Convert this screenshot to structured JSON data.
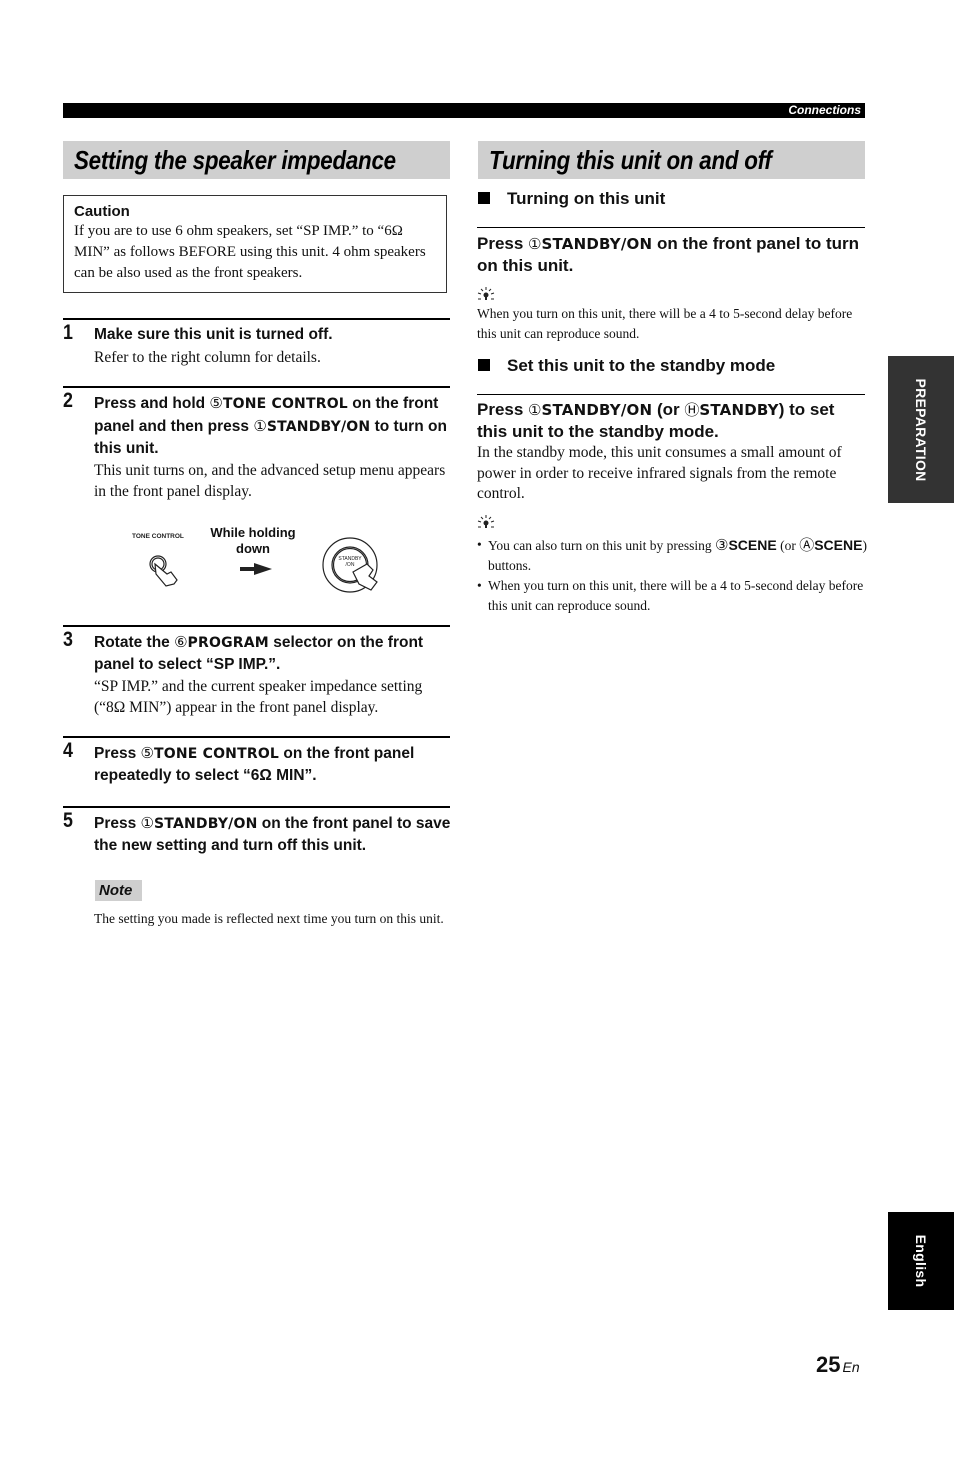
{
  "header": {
    "section": "Connections"
  },
  "left": {
    "title": "Setting the speaker impedance",
    "caution": {
      "heading": "Caution",
      "text": "If you are to use 6 ohm speakers, set “SP IMP.” to “6Ω MIN” as follows BEFORE using this unit. 4 ohm speakers can be also used as the front speakers."
    },
    "steps": [
      {
        "number": "1",
        "instruction": "Make sure this unit is turned off.",
        "description": "Refer to the right column for details."
      },
      {
        "number": "2",
        "instruction_parts": [
          "Press and hold ",
          "⑤",
          "TONE CONTROL",
          " on the front panel and then press ",
          "①",
          "STANDBY/ON",
          " to turn on this unit."
        ],
        "description": "This unit turns on, and the advanced setup menu appears in the front panel display."
      },
      {
        "number": "3",
        "instruction_parts": [
          "Rotate the ",
          "⑥",
          "PROGRAM",
          " selector on the front panel to select “SP IMP.”."
        ],
        "description": "“SP IMP.” and the current speaker impedance setting (“8Ω MIN”) appear in the front panel display."
      },
      {
        "number": "4",
        "instruction_parts": [
          "Press ",
          "⑤",
          "TONE CONTROL",
          " on the front panel repeatedly to select “6Ω MIN”."
        ]
      },
      {
        "number": "5",
        "instruction_parts": [
          "Press ",
          "①",
          "STANDBY/ON",
          " on the front panel to save the new setting and turn off this unit."
        ]
      }
    ],
    "illustration": {
      "tone_control_label": "TONE CONTROL",
      "while_holding": "While holding down",
      "standby_label": "STANDBY /ON"
    },
    "note": {
      "label": "Note",
      "text": "The setting you made is reflected next time you turn on this unit."
    }
  },
  "right": {
    "title": "Turning this unit on and off",
    "turning_on": {
      "heading": "Turning on this unit",
      "instruction_parts": [
        "Press ",
        "①",
        "STANDBY/ON",
        " on the front panel to turn on this unit."
      ],
      "hint_icon": "lightbulb-hint-icon",
      "hint": "When you turn on this unit, there will be a 4 to 5-second delay before this unit can reproduce sound."
    },
    "standby": {
      "heading": "Set this unit to the standby mode",
      "instruction_parts": [
        "Press ",
        "①",
        "STANDBY/ON",
        " (or ",
        "Ⓗ",
        "STANDBY",
        ") to set this unit to the standby mode."
      ],
      "description": "In the standby mode, this unit consumes a small amount of power in order to receive infrared signals from the remote control.",
      "hint_icon": "lightbulb-hint-icon",
      "bullets": [
        {
          "parts": [
            "You can also turn on this unit by pressing ",
            "③",
            "SCENE",
            " (or ",
            "Ⓐ",
            "SCENE",
            ") buttons."
          ]
        },
        {
          "text": "When you turn on this unit, there will be a 4 to 5-second delay before this unit can reproduce sound."
        }
      ]
    }
  },
  "side_tabs": {
    "preparation": "PREPARATION",
    "language": "English"
  },
  "footer": {
    "page_number": "25",
    "lang_code": "En"
  }
}
